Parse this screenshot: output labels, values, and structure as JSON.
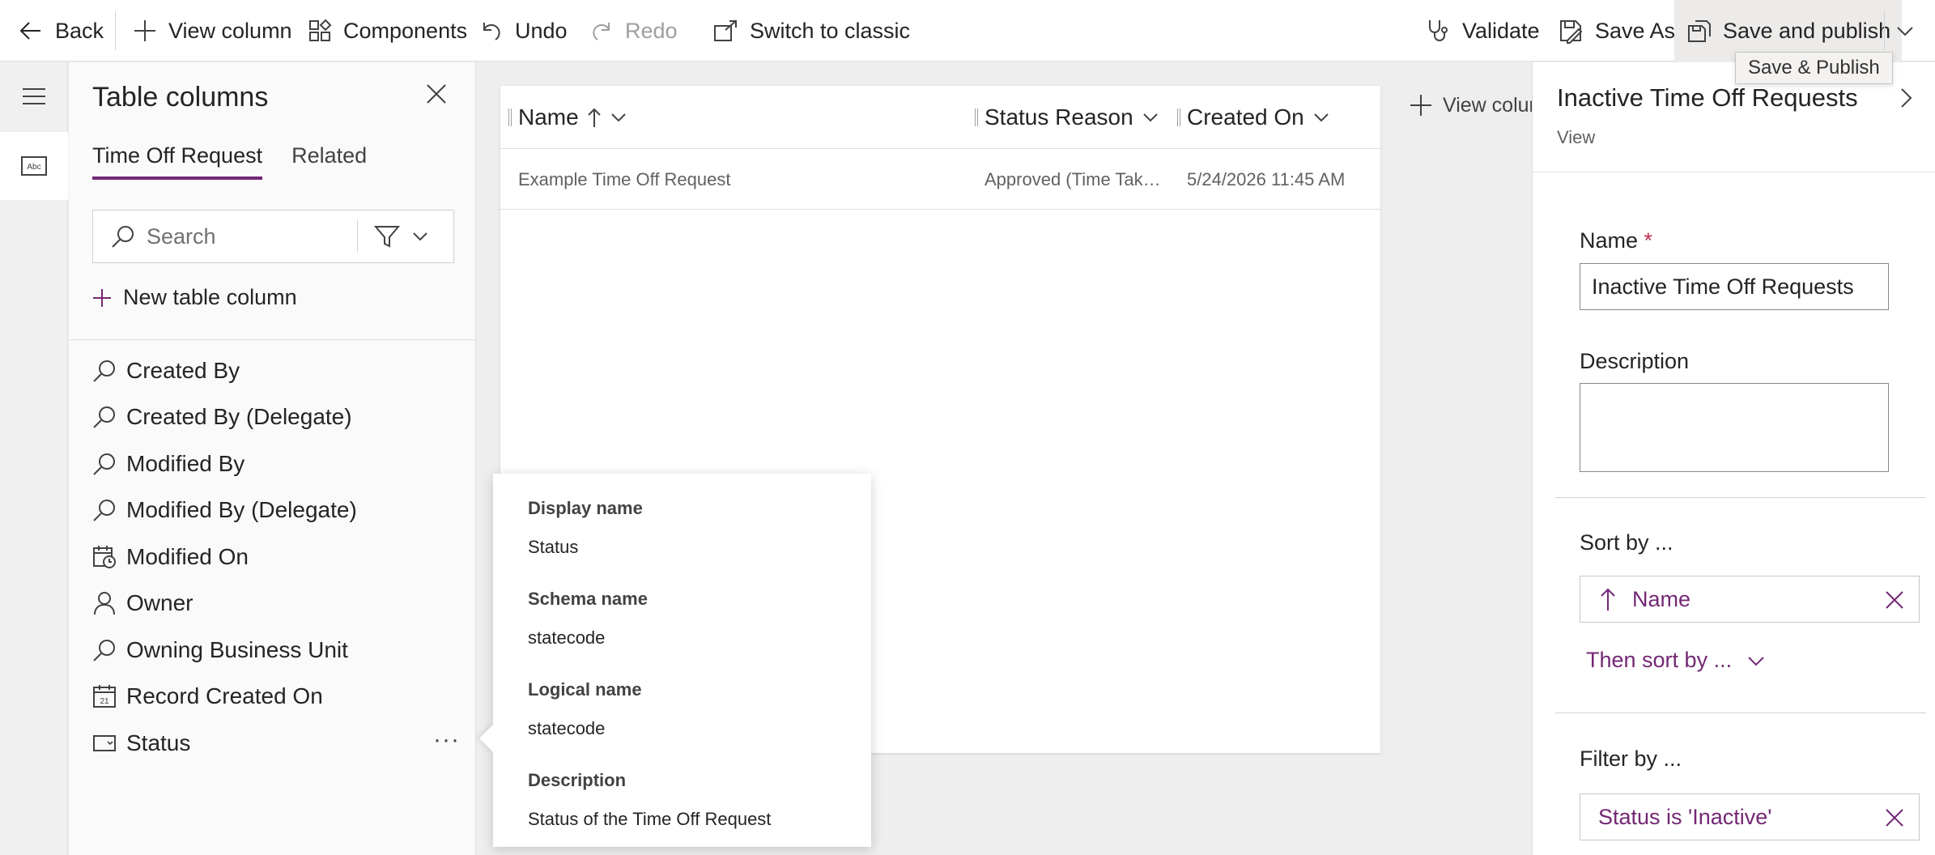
{
  "toolbar": {
    "back": "Back",
    "view_column": "View column",
    "components": "Components",
    "undo": "Undo",
    "redo": "Redo",
    "switch_classic": "Switch to classic",
    "validate": "Validate",
    "save_as": "Save As",
    "save_publish": "Save and publish",
    "save_publish_tooltip": "Save & Publish"
  },
  "rail": {
    "items": [
      "menu-icon",
      "textbox-icon"
    ]
  },
  "column_panel": {
    "title": "Table columns",
    "tabs": [
      {
        "label": "Time Off Request",
        "active": true
      },
      {
        "label": "Related",
        "active": false
      }
    ],
    "search": {
      "placeholder": "Search",
      "value": ""
    },
    "new_column": "New table column",
    "columns": [
      {
        "label": "Created By",
        "icon": "lookup-icon"
      },
      {
        "label": "Created By (Delegate)",
        "icon": "lookup-icon"
      },
      {
        "label": "Modified By",
        "icon": "lookup-icon"
      },
      {
        "label": "Modified By (Delegate)",
        "icon": "lookup-icon"
      },
      {
        "label": "Modified On",
        "icon": "datetime-icon"
      },
      {
        "label": "Owner",
        "icon": "person-icon"
      },
      {
        "label": "Owning Business Unit",
        "icon": "lookup-icon"
      },
      {
        "label": "Record Created On",
        "icon": "calendar-icon"
      },
      {
        "label": "Status",
        "icon": "choice-icon"
      }
    ]
  },
  "grid": {
    "columns": [
      {
        "label": "Name",
        "sort": "ascending"
      },
      {
        "label": "Status Reason"
      },
      {
        "label": "Created On"
      }
    ],
    "rows": [
      {
        "name": "Example Time Off Request",
        "status_reason": "Approved (Time Tak…",
        "created_on": "5/24/2026 11:45 AM"
      }
    ],
    "add_view_column": "View colum"
  },
  "callout": {
    "display_name_label": "Display name",
    "display_name": "Status",
    "schema_name_label": "Schema name",
    "schema_name": "statecode",
    "logical_name_label": "Logical name",
    "logical_name": "statecode",
    "description_label": "Description",
    "description": "Status of the Time Off Request"
  },
  "properties": {
    "title": "Inactive Time Off Requests",
    "subtitle": "View",
    "name_label": "Name",
    "required_mark": "*",
    "name_value": "Inactive Time Off Requests",
    "description_label": "Description",
    "description_value": "",
    "sort_label": "Sort by ...",
    "sort_field": "Name",
    "then_sort": "Then sort by ...",
    "filter_label": "Filter by ...",
    "filter_value": "Status is 'Inactive'"
  },
  "colors": {
    "accent": "#742774",
    "required": "#c4314b"
  }
}
